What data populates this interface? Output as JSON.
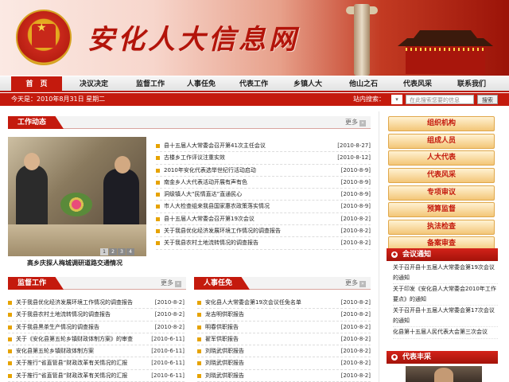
{
  "site": {
    "title": "安化人大信息网"
  },
  "nav": [
    {
      "label": "首　页",
      "active": true
    },
    {
      "label": "决议决定"
    },
    {
      "label": "监督工作"
    },
    {
      "label": "人事任免"
    },
    {
      "label": "代表工作"
    },
    {
      "label": "乡镇人大"
    },
    {
      "label": "他山之石"
    },
    {
      "label": "代表风采"
    },
    {
      "label": "联系我们"
    }
  ],
  "subbar": {
    "date": "今天是：2010年8月31日 星期二",
    "search_label": "站内搜索：",
    "search_scope": "▾",
    "search_placeholder": "在此搜索您要的信息",
    "search_button": "搜索"
  },
  "work": {
    "title": "工作动态",
    "more": "更多",
    "photo_caption": "高乡庆探人梅城调研道路交通情况",
    "pager": [
      "1",
      "2",
      "3",
      "4"
    ],
    "items": [
      {
        "t": "县十五届人大常委会召开第41次主任会议",
        "d": "[2010-8-27]"
      },
      {
        "t": "古楼乡工作评议注重实效",
        "d": "[2010-8-12]"
      },
      {
        "t": "2010年安化代表选举世纪行活动启动",
        "d": "[2010-8-9]"
      },
      {
        "t": "南金乡人大代表活动开展有声有色",
        "d": "[2010-8-9]"
      },
      {
        "t": "洞级镇人大“民情直达”直通民心",
        "d": "[2010-8-9]"
      },
      {
        "t": "市人大检查组来我县国家惠农政策落实情况",
        "d": "[2010-8-9]"
      },
      {
        "t": "县十五届人大常委会召开第19次会议",
        "d": "[2010-8-2]"
      },
      {
        "t": "关于我县优化经济发展环境工作情况的调查报告",
        "d": "[2010-8-2]"
      },
      {
        "t": "关于我县农村土地流转情况的调查报告",
        "d": "[2010-8-2]"
      }
    ]
  },
  "supervision": {
    "title": "监督工作",
    "more": "更多",
    "items": [
      {
        "t": "关于我县优化经济发展环境工作情况的调查报告",
        "d": "[2010-8-2]"
      },
      {
        "t": "关于我县农村土地流转情况的调查报告",
        "d": "[2010-8-2]"
      },
      {
        "t": "关于我县黑茶生产情况的调查报告",
        "d": "[2010-8-2]"
      },
      {
        "t": "关于《安化县第五轮乡镇财政体制方案》的审查",
        "d": "[2010-6-11]"
      },
      {
        "t": "安化县第五轮乡镇财政体制方案",
        "d": "[2010-6-11]"
      },
      {
        "t": "关于推行“省直管县”财政改革有关情况的汇报",
        "d": "[2010-6-11]"
      },
      {
        "t": "关于推行“省直管县”财政改革有关情况的汇报",
        "d": "[2010-6-11]"
      }
    ]
  },
  "personnel": {
    "title": "人事任免",
    "more": "更多",
    "items": [
      {
        "t": "安化县人大常委会第19次会议任免名单",
        "d": "[2010-8-2]"
      },
      {
        "t": "龙吉明供职报告",
        "d": "[2010-8-2]"
      },
      {
        "t": "明春供职报告",
        "d": "[2010-8-2]"
      },
      {
        "t": "翟军供职报告",
        "d": "[2010-8-2]"
      },
      {
        "t": "刘晓武供职报告",
        "d": "[2010-8-2]"
      },
      {
        "t": "刘晓武供职报告",
        "d": "[2010-8-2]"
      },
      {
        "t": "刘晓武供职报告",
        "d": "[2010-8-2]"
      }
    ]
  },
  "right_menu": [
    "组织机构",
    "组成人员",
    "人大代表",
    "代表风采",
    "专项审议",
    "预算监督",
    "执法检查",
    "备案审查"
  ],
  "meeting": {
    "title": "会议通知",
    "items": [
      "关于召开县十五届人大常委会第19次会议的通知",
      "关于印发《安化县人大常委会2010年工作要点》的通知",
      "关于召开县十五届人大常委会第17次会议的通知",
      "化县第十五届人民代表大会第三次会议"
    ]
  },
  "reps": {
    "title": "代表丰采"
  }
}
